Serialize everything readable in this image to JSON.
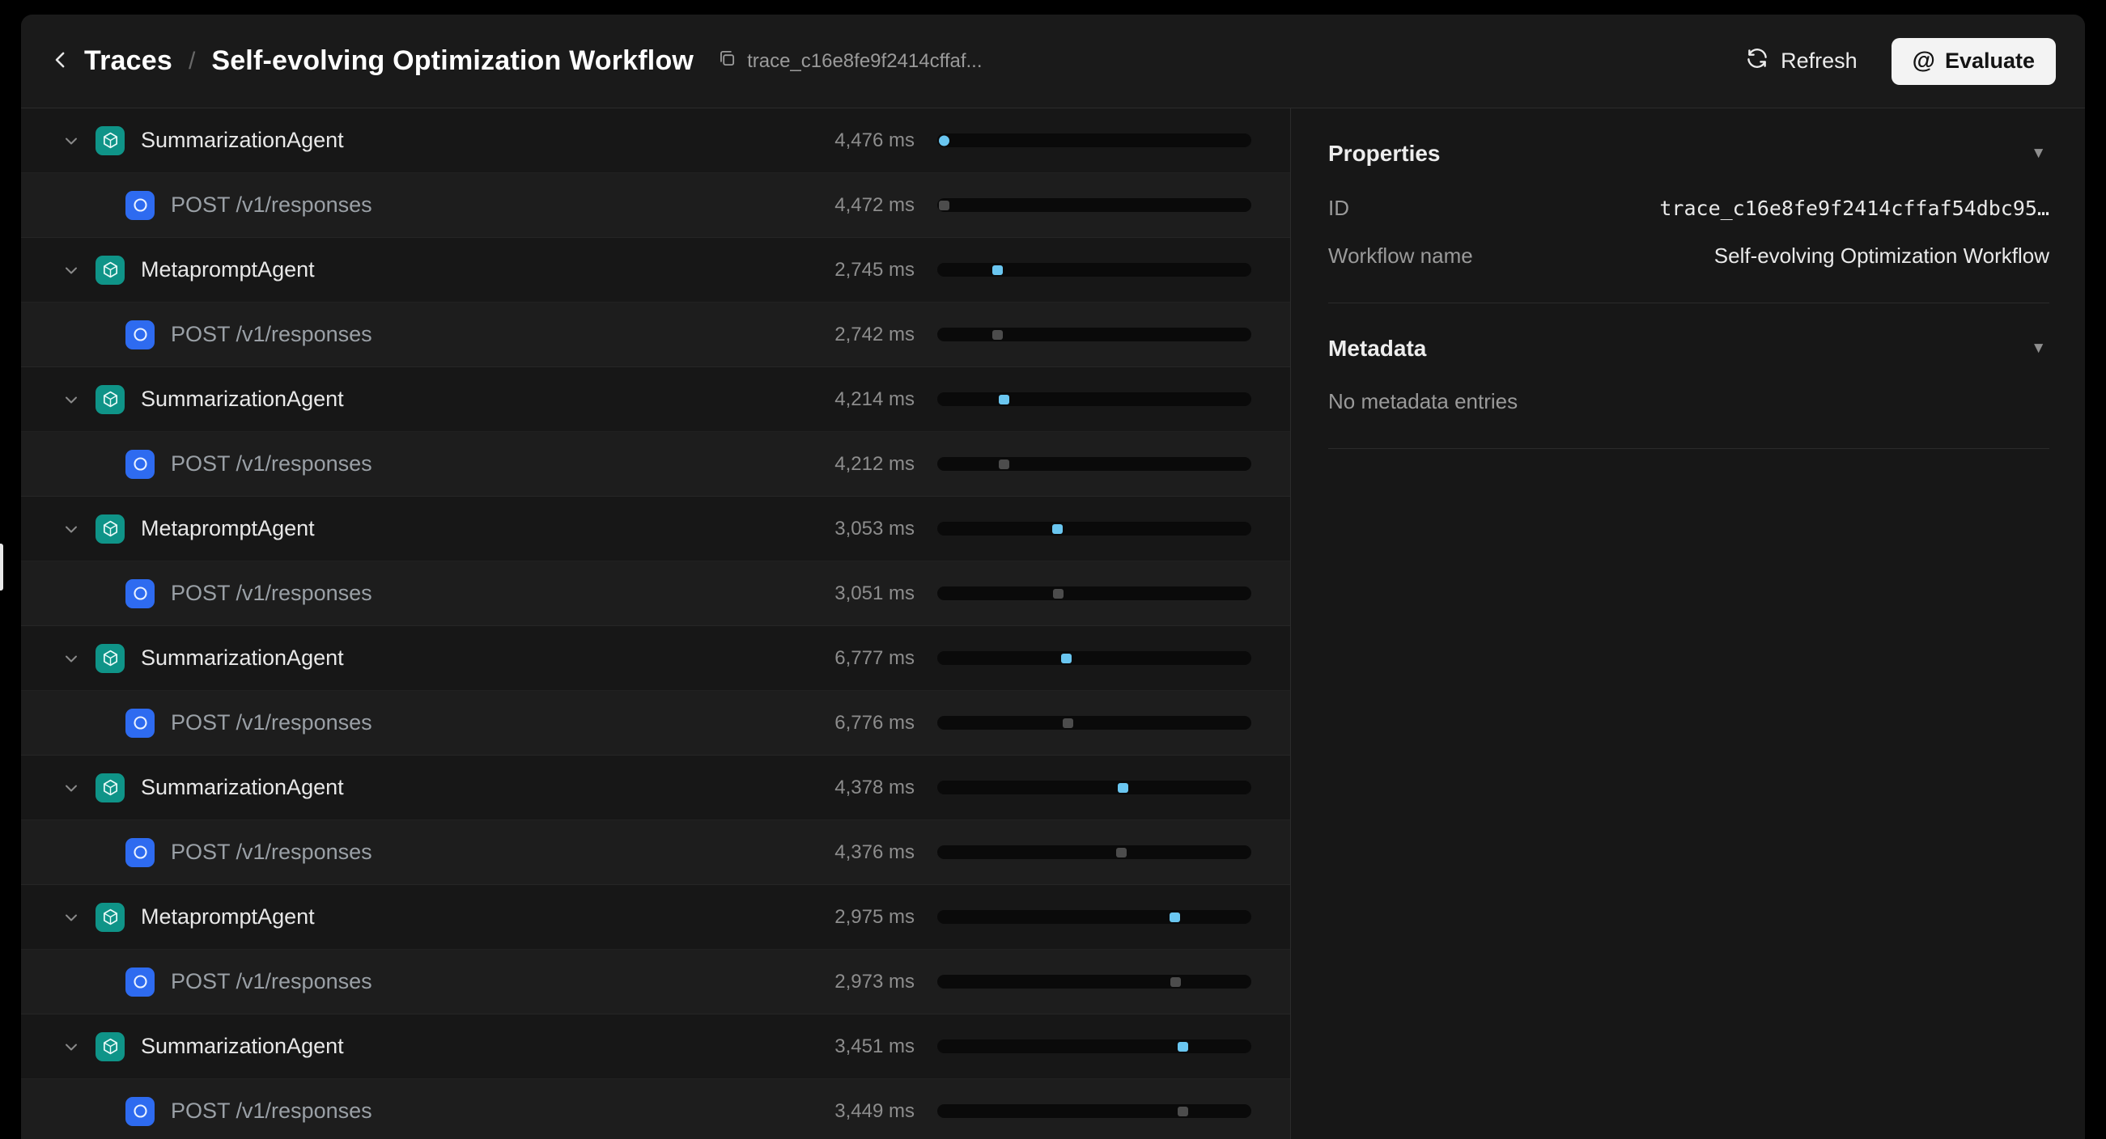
{
  "header": {
    "breadcrumb": "Traces",
    "separator": "/",
    "title": "Self-evolving Optimization Workflow",
    "trace_id_chip": "trace_c16e8fe9f2414cffaf...",
    "refresh_label": "Refresh",
    "evaluate_label": "Evaluate",
    "evaluate_icon": "@"
  },
  "icons": {
    "collapse": "▼"
  },
  "colors": {
    "accent": "#6ac6f0",
    "marker_muted": "#4c4c4c",
    "agent_icon_bg": "#0f9488",
    "endpoint_icon_bg": "#2e6bf0"
  },
  "trace": {
    "rows": [
      {
        "type": "agent",
        "label": "SummarizationAgent",
        "duration": "4,476 ms",
        "offset_pct": 0.5
      },
      {
        "type": "http",
        "label": "POST /v1/responses",
        "duration": "4,472 ms",
        "offset_pct": 0.5
      },
      {
        "type": "agent",
        "label": "MetapromptAgent",
        "duration": "2,745 ms",
        "offset_pct": 17.5
      },
      {
        "type": "http",
        "label": "POST /v1/responses",
        "duration": "2,742 ms",
        "offset_pct": 17.5
      },
      {
        "type": "agent",
        "label": "SummarizationAgent",
        "duration": "4,214 ms",
        "offset_pct": 19.5
      },
      {
        "type": "http",
        "label": "POST /v1/responses",
        "duration": "4,212 ms",
        "offset_pct": 19.5
      },
      {
        "type": "agent",
        "label": "MetapromptAgent",
        "duration": "3,053 ms",
        "offset_pct": 36.5
      },
      {
        "type": "http",
        "label": "POST /v1/responses",
        "duration": "3,051 ms",
        "offset_pct": 36.8
      },
      {
        "type": "agent",
        "label": "SummarizationAgent",
        "duration": "6,777 ms",
        "offset_pct": 39.5
      },
      {
        "type": "http",
        "label": "POST /v1/responses",
        "duration": "6,776 ms",
        "offset_pct": 40.0
      },
      {
        "type": "agent",
        "label": "SummarizationAgent",
        "duration": "4,378 ms",
        "offset_pct": 57.5
      },
      {
        "type": "http",
        "label": "POST /v1/responses",
        "duration": "4,376 ms",
        "offset_pct": 57.0
      },
      {
        "type": "agent",
        "label": "MetapromptAgent",
        "duration": "2,975 ms",
        "offset_pct": 74.0
      },
      {
        "type": "http",
        "label": "POST /v1/responses",
        "duration": "2,973 ms",
        "offset_pct": 74.3
      },
      {
        "type": "agent",
        "label": "SummarizationAgent",
        "duration": "3,451 ms",
        "offset_pct": 76.5
      },
      {
        "type": "http",
        "label": "POST /v1/responses",
        "duration": "3,449 ms",
        "offset_pct": 76.5
      }
    ]
  },
  "panel": {
    "properties": {
      "title": "Properties",
      "rows": [
        {
          "label": "ID",
          "value": "trace_c16e8fe9f2414cffaf54dbc95…"
        },
        {
          "label": "Workflow name",
          "value": "Self-evolving Optimization Workflow"
        }
      ]
    },
    "metadata": {
      "title": "Metadata",
      "empty_text": "No metadata entries"
    }
  }
}
